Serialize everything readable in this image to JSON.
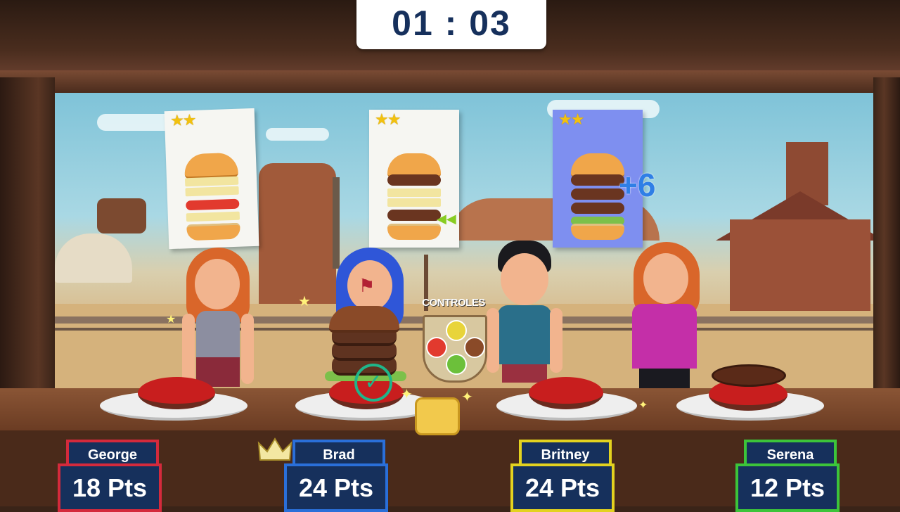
{
  "hud": {
    "timer": "01 : 03"
  },
  "controls": {
    "label": "CONTROLES"
  },
  "orders": [
    {
      "stars": "★★",
      "active": false,
      "layers": [
        "bun-top",
        "cheese",
        "cheese",
        "tomato",
        "cheese",
        "bun-bottom"
      ]
    },
    {
      "stars": "★★",
      "active": false,
      "layers": [
        "bun-top",
        "patty",
        "cheese",
        "cheese",
        "patty",
        "bun-bottom"
      ]
    },
    {
      "stars": "★★",
      "active": true,
      "layers": [
        "bun-top",
        "patty",
        "patty",
        "patty",
        "lettuce",
        "bun-bottom"
      ],
      "bonus": "+6"
    }
  ],
  "players": [
    {
      "name": "George",
      "score": "18 Pts",
      "color": "#d42a3c"
    },
    {
      "name": "Brad",
      "score": "24 Pts",
      "color": "#2a6fd9"
    },
    {
      "name": "Britney",
      "score": "24 Pts",
      "color": "#e3d21f"
    },
    {
      "name": "Serena",
      "score": "12 Pts",
      "color": "#3cc43a"
    }
  ],
  "icons": [
    "stars-icon",
    "burger-icon",
    "checkmark-icon",
    "crown-icon",
    "flag-icon",
    "sparkle-icon"
  ]
}
